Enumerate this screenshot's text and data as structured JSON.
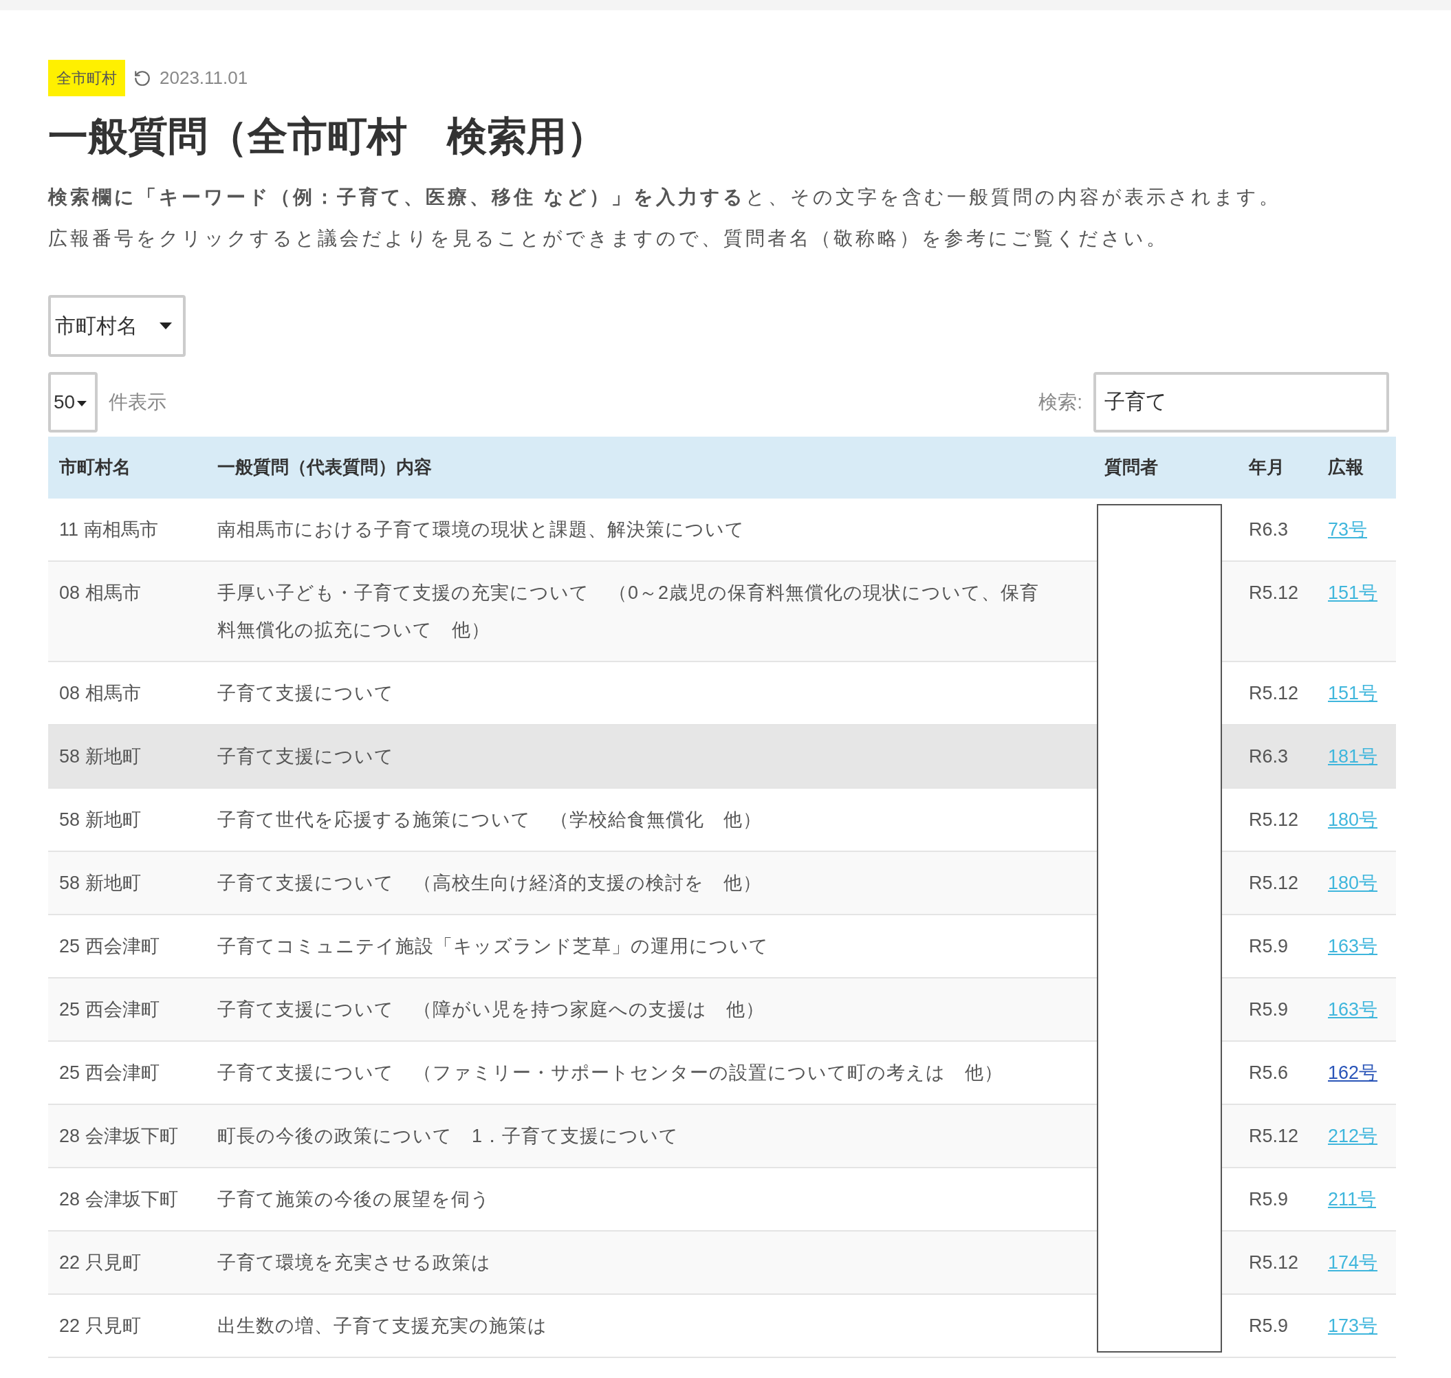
{
  "badge": "全市町村",
  "updated": "2023.11.01",
  "title": "一般質問（全市町村　検索用）",
  "description": [
    "**検索欄に「キーワード（例：子育て、医療、移住 など）」を入力する**と、その文字を含む一般質問の内容が表示されます。",
    "広報番号をクリックすると議会だよりを見ることができますので、質問者名（敬称略）を参考にご覧ください。"
  ],
  "municipality_select": {
    "value": "市町村名"
  },
  "length_select": {
    "value": "50",
    "label": "件表示"
  },
  "search": {
    "label": "検索:",
    "value": "子育て"
  },
  "table": {
    "columns": [
      "市町村名",
      "一般質問（代表質問）内容",
      "質問者",
      "年月",
      "広報"
    ],
    "rows": [
      {
        "municipality": "11 南相馬市",
        "content": "南相馬市における子育て環境の現状と課題、解決策について",
        "date": "R6.3",
        "issue": "73号",
        "visited": false,
        "highlighted": false
      },
      {
        "municipality": "08 相馬市",
        "content": "手厚い子ども・子育て支援の充実について　（0～2歳児の保育料無償化の現状について、保育料無償化の拡充について　他）",
        "date": "R5.12",
        "issue": "151号",
        "visited": false,
        "highlighted": false
      },
      {
        "municipality": "08 相馬市",
        "content": "子育て支援について",
        "date": "R5.12",
        "issue": "151号",
        "visited": false,
        "highlighted": false
      },
      {
        "municipality": "58 新地町",
        "content": "子育て支援について",
        "date": "R6.3",
        "issue": "181号",
        "visited": false,
        "highlighted": true
      },
      {
        "municipality": "58 新地町",
        "content": "子育て世代を応援する施策について　（学校給食無償化　他）",
        "date": "R5.12",
        "issue": "180号",
        "visited": false,
        "highlighted": false
      },
      {
        "municipality": "58 新地町",
        "content": "子育て支援について　（高校生向け経済的支援の検討を　他）",
        "date": "R5.12",
        "issue": "180号",
        "visited": false,
        "highlighted": false
      },
      {
        "municipality": "25 西会津町",
        "content": "子育てコミュニテイ施設「キッズランド芝草」の運用について",
        "date": "R5.9",
        "issue": "163号",
        "visited": false,
        "highlighted": false
      },
      {
        "municipality": "25 西会津町",
        "content": "子育て支援について　（障がい児を持つ家庭への支援は　他）",
        "date": "R5.9",
        "issue": "163号",
        "visited": false,
        "highlighted": false
      },
      {
        "municipality": "25 西会津町",
        "content": "子育て支援について　（ファミリー・サポートセンターの設置について町の考えは　他）",
        "date": "R5.6",
        "issue": "162号",
        "visited": true,
        "highlighted": false
      },
      {
        "municipality": "28 会津坂下町",
        "content": "町長の今後の政策について　1．子育て支援について",
        "date": "R5.12",
        "issue": "212号",
        "visited": false,
        "highlighted": false
      },
      {
        "municipality": "28 会津坂下町",
        "content": "子育て施策の今後の展望を伺う",
        "date": "R5.9",
        "issue": "211号",
        "visited": false,
        "highlighted": false
      },
      {
        "municipality": "22 只見町",
        "content": "子育て環境を充実させる政策は",
        "date": "R5.12",
        "issue": "174号",
        "visited": false,
        "highlighted": false
      },
      {
        "municipality": "22 只見町",
        "content": "出生数の増、子育て支援充実の施策は",
        "date": "R5.9",
        "issue": "173号",
        "visited": false,
        "highlighted": false
      }
    ]
  }
}
